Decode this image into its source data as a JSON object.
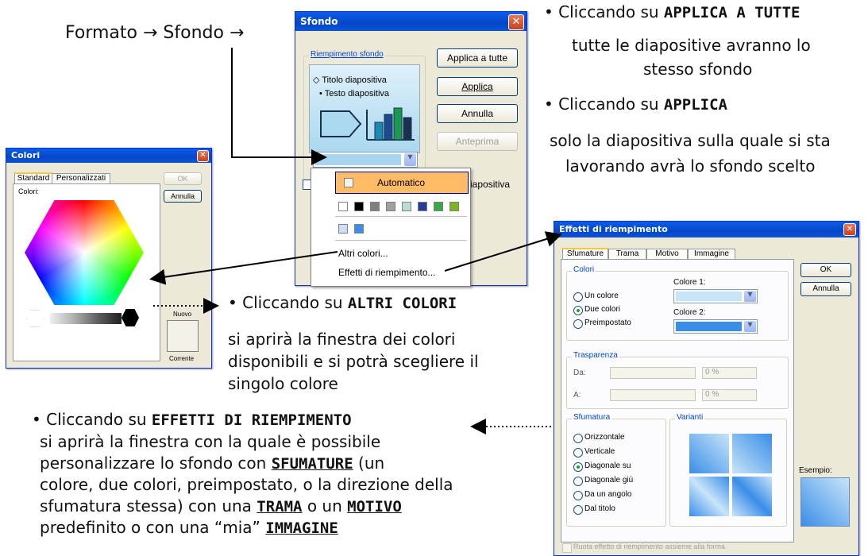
{
  "menu_path": "Formato → Sfondo →",
  "sfondo_dialog": {
    "title": "Sfondo",
    "group_label": "Riempimento sfondo",
    "preview_title": "Titolo diapositiva",
    "preview_text": "Testo diapositiva",
    "btn_apply_all": "Applica a tutte",
    "btn_apply": "Applica",
    "btn_cancel": "Annulla",
    "btn_preview": "Anteprima",
    "partial_checkbox_text": "iapositiva"
  },
  "color_dropdown": {
    "automatic": "Automatico",
    "more_colors": "Altri colori...",
    "fill_effects": "Effetti di riempimento...",
    "swatches": [
      "#ffffff",
      "#000000",
      "#808080",
      "#a0a0a0",
      "#b8dcd8",
      "#2a3a9a",
      "#3aa848",
      "#7ab81a"
    ],
    "recent": [
      "#c8e0f8",
      "#3a8ee8"
    ]
  },
  "colors_dialog": {
    "title": "Colori",
    "tab_standard": "Standard",
    "tab_custom": "Personalizzati",
    "colors_label": "Colori:",
    "btn_ok": "OK",
    "btn_cancel": "Annulla",
    "new_label": "Nuovo",
    "current_label": "Corrente"
  },
  "fill_dialog": {
    "title": "Effetti di riempimento",
    "tabs": [
      "Sfumature",
      "Trama",
      "Motivo",
      "Immagine"
    ],
    "btn_ok": "OK",
    "btn_cancel": "Annulla",
    "colors_group": "Colori",
    "radio_one": "Un colore",
    "radio_two": "Due colori",
    "radio_preset": "Preimpostato",
    "color1": "Colore 1:",
    "color2": "Colore 2:",
    "transparency_group": "Trasparenza",
    "from_label": "Da:",
    "to_label": "A:",
    "pct1": "0 %",
    "pct2": "0 %",
    "shading_group": "Sfumatura",
    "variants_label": "Varianti",
    "styles": [
      "Orizzontale",
      "Verticale",
      "Diagonale su",
      "Diagonale giù",
      "Da un angolo",
      "Dal titolo"
    ],
    "example_label": "Esempio:",
    "rotate_text": "Ruota effetto di riempimento assieme alla forma"
  },
  "notes": {
    "n1_prefix": "• Cliccando su ",
    "n1_bold": "APPLICA A TUTTE",
    "n1_rest1": "tutte le diapositive avranno lo",
    "n1_rest2": "stesso sfondo",
    "n2_prefix": "• Cliccando su ",
    "n2_bold": "APPLICA",
    "n2_rest1": "solo la diapositiva sulla quale si sta",
    "n2_rest2": "lavorando avrà lo sfondo scelto",
    "n3_prefix": "• Cliccando su ",
    "n3_bold": "ALTRI COLORI",
    "n3_rest1": "si aprirà la finestra dei colori",
    "n3_rest2": "disponibili e si potrà scegliere il",
    "n3_rest3": "singolo colore",
    "n4_prefix": "• Cliccando su ",
    "n4_bold": "EFFETTI DI RIEMPIMENTO",
    "n4_l1": "si aprirà la finestra con la quale è possibile",
    "n4_l2a": "personalizzare lo sfondo con ",
    "n4_l2u": "SFUMATURE",
    "n4_l2b": " (un",
    "n4_l3": "colore, due colori, preimpostato, o la direzione della",
    "n4_l4a": "sfumatura stessa) con una ",
    "n4_l4u1": "TRAMA",
    "n4_l4b": " o un ",
    "n4_l4u2": "MOTIVO",
    "n5a": "predefinito o con una “mia” ",
    "n5u": "IMMAGINE"
  }
}
